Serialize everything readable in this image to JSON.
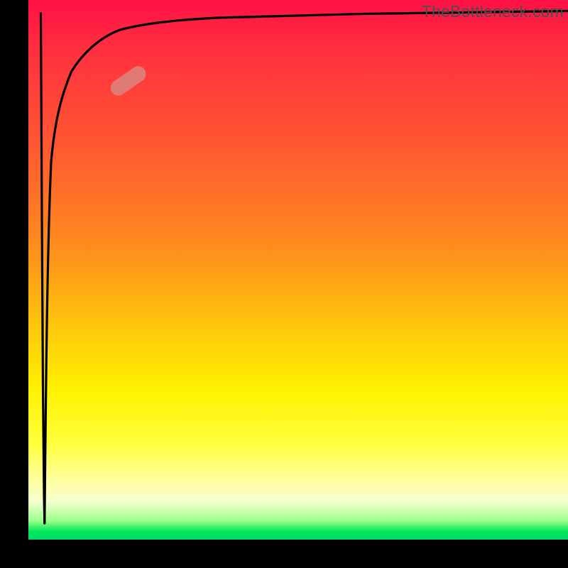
{
  "watermark": "TheBottleneck.com",
  "colors": {
    "gradient_top": "#ff0f45",
    "gradient_bottom": "#00db6b",
    "curve": "#000000",
    "marker_fill": "#d88b85",
    "marker_opacity": 0.78
  },
  "chart_data": {
    "type": "line",
    "title": "",
    "xlabel": "",
    "ylabel": "",
    "xlim": [
      0,
      100
    ],
    "ylim": [
      0,
      100
    ],
    "x": [
      3.0,
      3.3,
      3.6,
      4.2,
      5.0,
      6.4,
      8.0,
      10.0,
      13.0,
      17.0,
      22.0,
      28.0,
      35.0,
      43.0,
      52.0,
      62.0,
      73.0,
      85.0,
      100.0
    ],
    "y_down": [
      97.5,
      60.0,
      28.0,
      8.0,
      3.0
    ],
    "x_down": [
      2.3,
      2.5,
      2.7,
      2.9,
      3.0
    ],
    "values": [
      3.0,
      34.0,
      55.0,
      70.0,
      78.0,
      83.5,
      86.8,
      89.0,
      90.7,
      92.0,
      93.0,
      93.8,
      94.3,
      94.8,
      95.2,
      95.5,
      95.7,
      95.9,
      96.0
    ],
    "marker": {
      "x_center": 18.5,
      "y_center": 85.0,
      "angle_deg": -35
    },
    "notes": "Bottleneck percentage curve: initial vertical spike near x≈3 dropping from ~98% to ~3%, then rising asymptotically toward ~96%."
  }
}
